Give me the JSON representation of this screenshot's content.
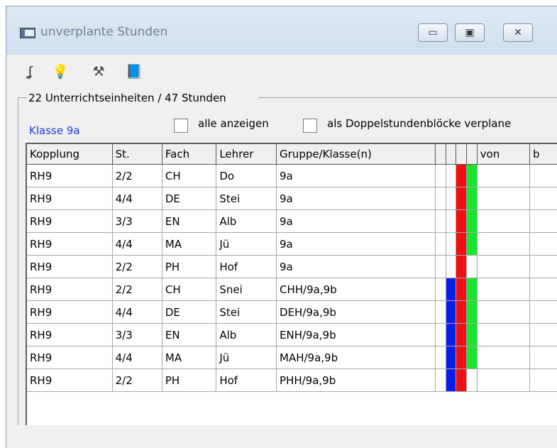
{
  "window": {
    "title": "unverplante Stunden",
    "buttons": [
      "▭",
      "▣",
      "✕"
    ]
  },
  "toolbar": {
    "icons": [
      "hook-icon",
      "lightbulb-icon",
      "tools-icon",
      "book-icon"
    ]
  },
  "summary": "22 Unterrichtseinheiten / 47 Stunden",
  "klasse": "Klasse 9a",
  "options": {
    "show_all": {
      "label": "alle anzeigen",
      "checked": false
    },
    "double_blocks": {
      "label": "als Doppelstundenblöcke verplane",
      "checked": false
    }
  },
  "table": {
    "headers": [
      "Kopplung",
      "St.",
      "Fach",
      "Lehrer",
      "Gruppe/Klasse(n)",
      "",
      "",
      "",
      "",
      "von",
      "b"
    ],
    "rows": [
      {
        "kopplung": "RH9",
        "st": "2/2",
        "fach": "CH",
        "lehrer": "Do",
        "gruppe": "9a",
        "blue": false,
        "red": true,
        "green": true
      },
      {
        "kopplung": "RH9",
        "st": "4/4",
        "fach": "DE",
        "lehrer": "Stei",
        "gruppe": "9a",
        "blue": false,
        "red": true,
        "green": true
      },
      {
        "kopplung": "RH9",
        "st": "3/3",
        "fach": "EN",
        "lehrer": "Alb",
        "gruppe": "9a",
        "blue": false,
        "red": true,
        "green": true
      },
      {
        "kopplung": "RH9",
        "st": "4/4",
        "fach": "MA",
        "lehrer": "Jü",
        "gruppe": "9a",
        "blue": false,
        "red": true,
        "green": true
      },
      {
        "kopplung": "RH9",
        "st": "2/2",
        "fach": "PH",
        "lehrer": "Hof",
        "gruppe": "9a",
        "blue": false,
        "red": true,
        "green": false
      },
      {
        "kopplung": "RH9",
        "st": "2/2",
        "fach": "CH",
        "lehrer": "Snei",
        "gruppe": "CHH/9a,9b",
        "blue": true,
        "red": true,
        "green": true
      },
      {
        "kopplung": "RH9",
        "st": "4/4",
        "fach": "DE",
        "lehrer": "Stei",
        "gruppe": "DEH/9a,9b",
        "blue": true,
        "red": true,
        "green": true
      },
      {
        "kopplung": "RH9",
        "st": "3/3",
        "fach": "EN",
        "lehrer": "Alb",
        "gruppe": "ENH/9a,9b",
        "blue": true,
        "red": true,
        "green": true
      },
      {
        "kopplung": "RH9",
        "st": "4/4",
        "fach": "MA",
        "lehrer": "Jü",
        "gruppe": "MAH/9a,9b",
        "blue": true,
        "red": true,
        "green": true
      },
      {
        "kopplung": "RH9",
        "st": "2/2",
        "fach": "PH",
        "lehrer": "Hof",
        "gruppe": "PHH/9a,9b",
        "blue": true,
        "red": true,
        "green": false
      }
    ]
  },
  "colors": {
    "blue": "#0a1ee8",
    "red": "#ee1111",
    "green": "#17e52e",
    "klasse_text": "#1a3ae0"
  }
}
